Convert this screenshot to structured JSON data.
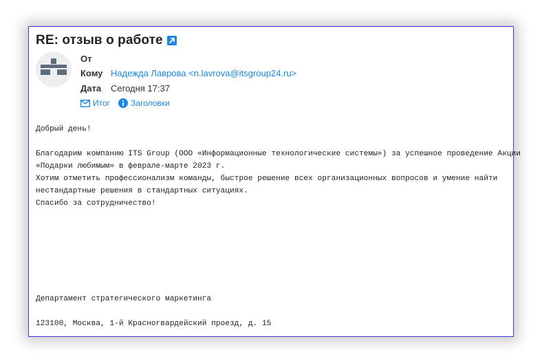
{
  "email": {
    "subject": "RE: отзыв о работе",
    "from_label": "От",
    "to_label": "Кому",
    "to_value": "Надежда Лаврова <n.lavrova@itsgroup24.ru>",
    "date_label": "Дата",
    "date_value": "Сегодня 17:37",
    "actions": {
      "summary": "Итог",
      "headers": "Заголовки"
    },
    "body_lines": [
      "Добрый день!",
      "",
      "Благодарим компанию ITS Group (ООО «Информационные технологические системы») за успешное проведение Акции",
      "«Подарки любимым» в феврале-марте 2023 г.",
      "Хотим отметить профессионализм команды, быстрое решение всех организационных вопросов и умение найти",
      "нестандартные решения в стандартных ситуациях.",
      "Спасибо за сотрудничество!"
    ],
    "signature_department": "Департамент стратегического маркетинга",
    "signature_address": "123100, Москва, 1-й Красногвардейский проезд, д. 15"
  },
  "colors": {
    "accent": "#1d86e0",
    "border": "#3a3ad0",
    "text": "#222222"
  },
  "icons": {
    "external": "external-link-icon",
    "avatar": "org-chart-icon",
    "summary": "envelope-icon",
    "headers": "info-icon"
  }
}
